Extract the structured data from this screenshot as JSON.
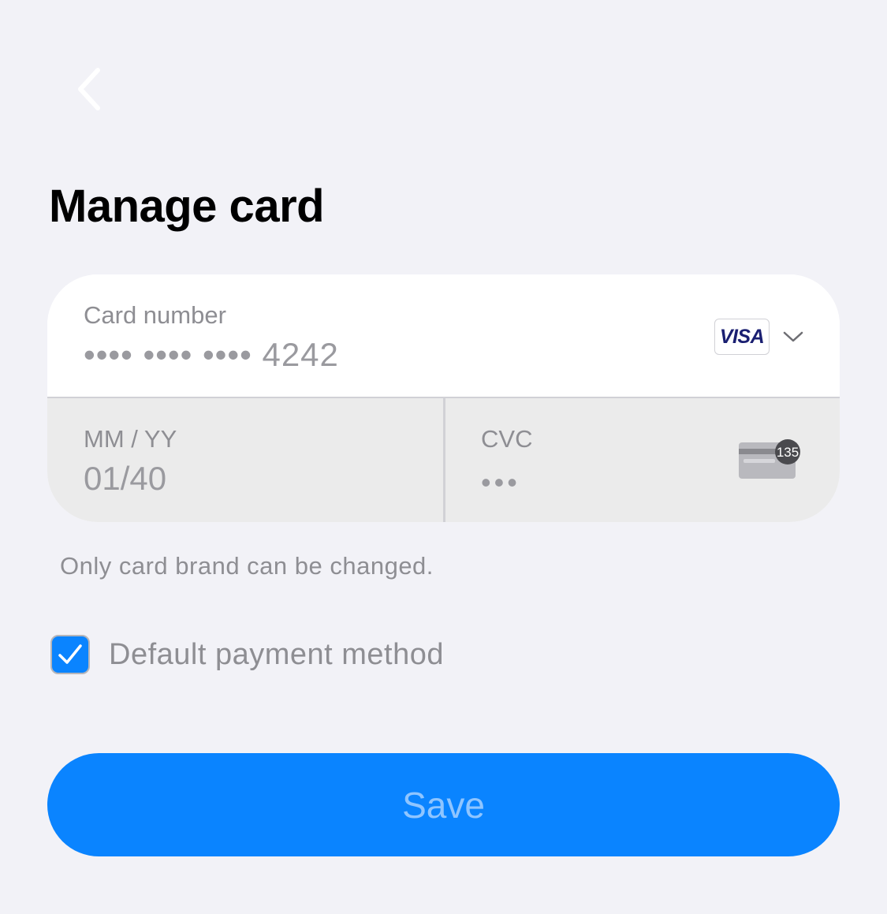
{
  "header": {
    "back_icon": "chevron-left-icon",
    "title": "Manage card"
  },
  "card_form": {
    "card_number": {
      "label": "Card number",
      "value": "•••• •••• •••• 4242"
    },
    "brand": {
      "name": "VISA",
      "icon": "chevron-down-icon"
    },
    "expiry": {
      "label": "MM / YY",
      "value": "01/40"
    },
    "cvc": {
      "label": "CVC",
      "value": "•••",
      "icon": "cvc-card-icon",
      "icon_text": "135"
    }
  },
  "helper_text": "Only card brand can be changed.",
  "default_payment": {
    "label": "Default payment method",
    "checked": true
  },
  "save_button": {
    "label": "Save"
  },
  "colors": {
    "background": "#f2f2f7",
    "accent": "#0a84ff",
    "disabled_field": "#ebebeb",
    "save_label_disabled": "#8fc5ff",
    "visa_blue": "#1a1f71"
  }
}
